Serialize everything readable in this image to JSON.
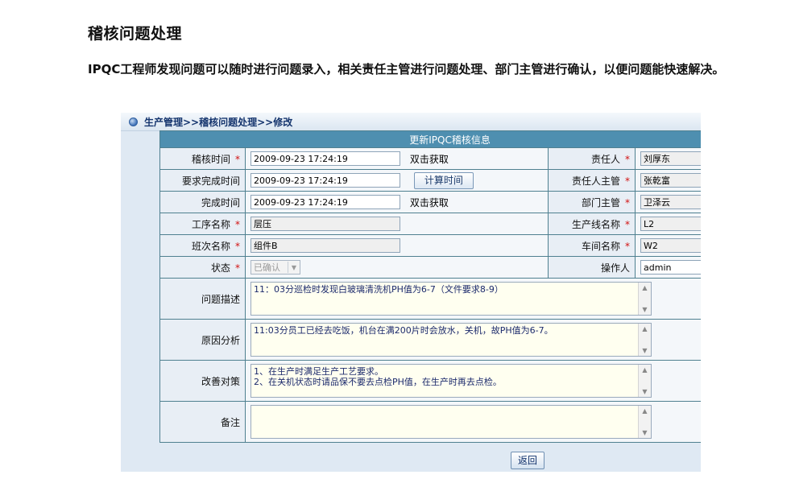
{
  "doc": {
    "title": "稽核问题处理",
    "description": "IPQC工程师发现问题可以随时进行问题录入，相关责任主管进行问题处理、部门主管进行确认，以便问题能快速解决。"
  },
  "breadcrumb": "生产管理>>稽核问题处理>>修改",
  "form": {
    "header": "更新IPQC稽核信息",
    "audit_time_label": "稽核时间",
    "audit_time_value": "2009-09-23 17:24:19",
    "dblclick_hint": "双击获取",
    "due_time_label": "要求完成时间",
    "due_time_value": "2009-09-23 17:24:19",
    "calc_button": "计算时间",
    "done_time_label": "完成时间",
    "done_time_value": "2009-09-23 17:24:19",
    "process_label": "工序名称",
    "process_value": "层压",
    "shift_label": "班次名称",
    "shift_value": "组件B",
    "status_label": "状态",
    "status_value": "已确认",
    "owner_label": "责任人",
    "owner_value": "刘厚东",
    "owner_mgr_label": "责任人主管",
    "owner_mgr_value": "张乾富",
    "dept_mgr_label": "部门主管",
    "dept_mgr_value": "卫泽云",
    "line_label": "生产线名称",
    "line_value": "L2",
    "workshop_label": "车间名称",
    "workshop_value": "W2",
    "operator_label": "操作人",
    "operator_value": "admin",
    "problem_label": "问题描述",
    "problem_value": "11：03分巡检时发现白玻璃清洗机PH值为6-7（文件要求8-9）",
    "cause_label": "原因分析",
    "cause_value": "11:03分员工已经去吃饭，机台在满200片时会放水，关机，故PH值为6-7。",
    "measure_label": "改善对策",
    "measure_line1": "1、在生产时满足生产工艺要求。",
    "measure_line2": "2、在关机状态时请品保不要去点检PH值，在生产时再去点检。",
    "remark_label": "备注",
    "remark_value": "",
    "required_mark": "*",
    "back_button": "返回"
  }
}
